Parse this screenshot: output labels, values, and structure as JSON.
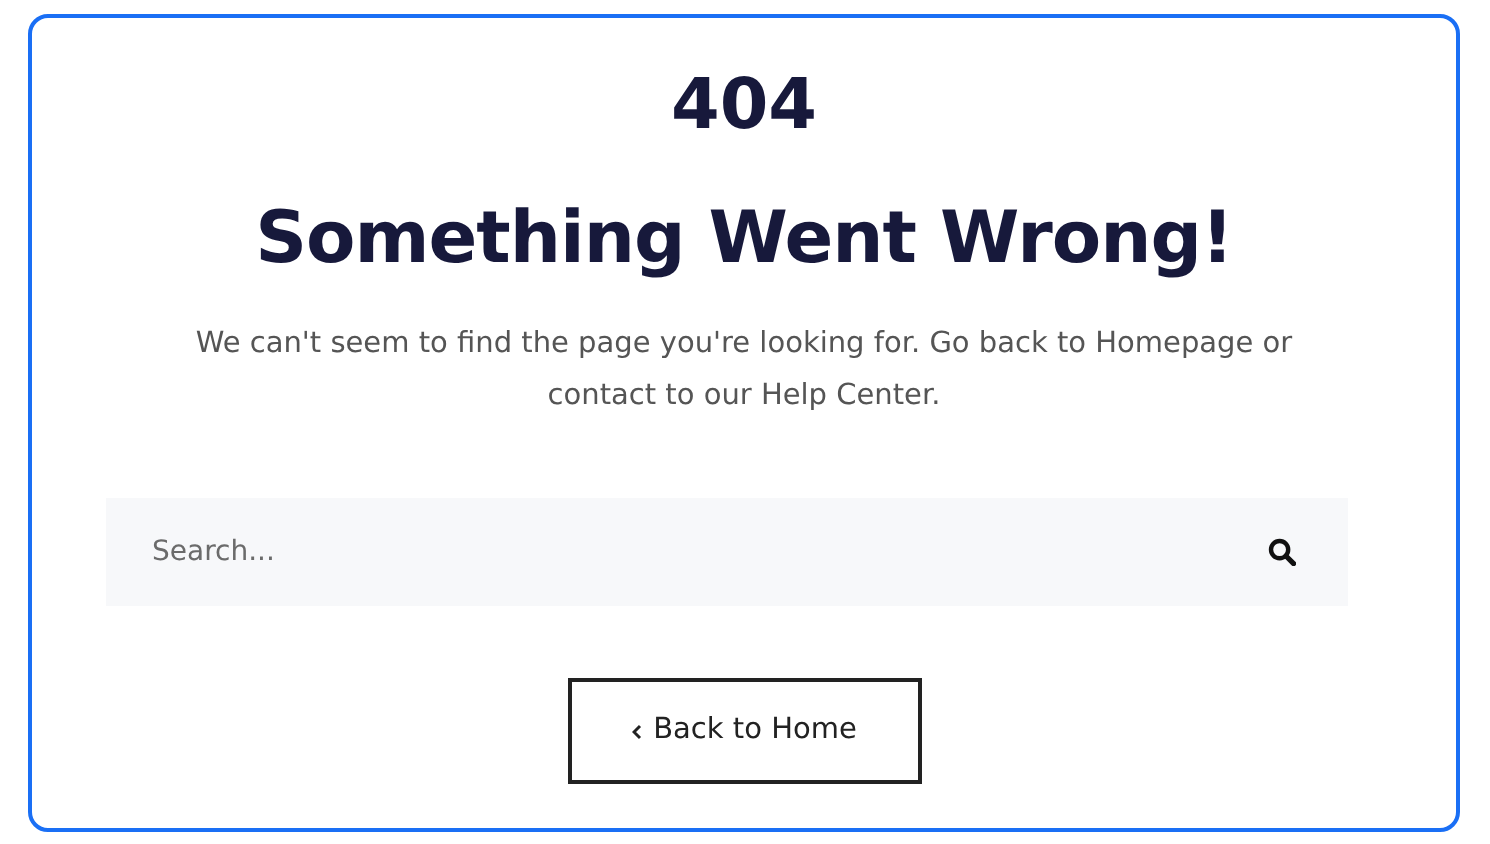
{
  "error_code": "404",
  "heading": "Something Went Wrong!",
  "message": "We can't seem to find the page you're looking for. Go back to Homepage or contact to our Help Center.",
  "search": {
    "placeholder": "Search..."
  },
  "button": {
    "label": "Back to Home"
  }
}
